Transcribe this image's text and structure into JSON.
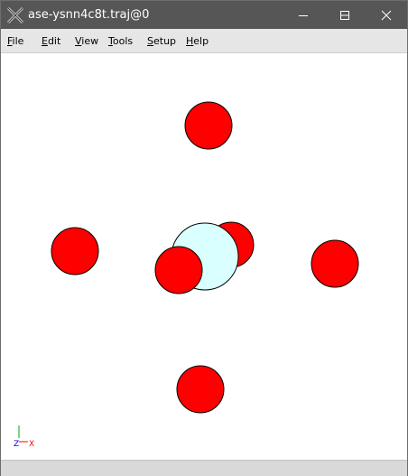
{
  "window": {
    "title": "ase-ysnn4c8t.traj@0"
  },
  "titlebar_buttons": {
    "minimize_icon": "minimize-icon",
    "maximize_icon": "maximize-icon",
    "close_icon": "close-icon"
  },
  "menu": {
    "file": "File",
    "edit": "Edit",
    "view": "View",
    "tools": "Tools",
    "setup": "Setup",
    "help": "Help"
  },
  "viewer": {
    "atoms": [
      {
        "element": "O",
        "color": "#ff0000"
      },
      {
        "element": "O",
        "color": "#ff0000"
      },
      {
        "element": "O",
        "color": "#ff0000"
      },
      {
        "element": "O",
        "color": "#ff0000"
      },
      {
        "element": "O",
        "color": "#ff0000"
      },
      {
        "element": "metal",
        "color": "#d9ffff"
      },
      {
        "element": "O",
        "color": "#ff0000"
      }
    ],
    "axes": {
      "z_label": "Z",
      "x_label": "X",
      "z_color": "#0000ff",
      "x_color": "#ff0000"
    }
  },
  "colors": {
    "titlebar": "#565656",
    "menubar": "#e6e6e6",
    "statusbar": "#d9d9d9"
  }
}
